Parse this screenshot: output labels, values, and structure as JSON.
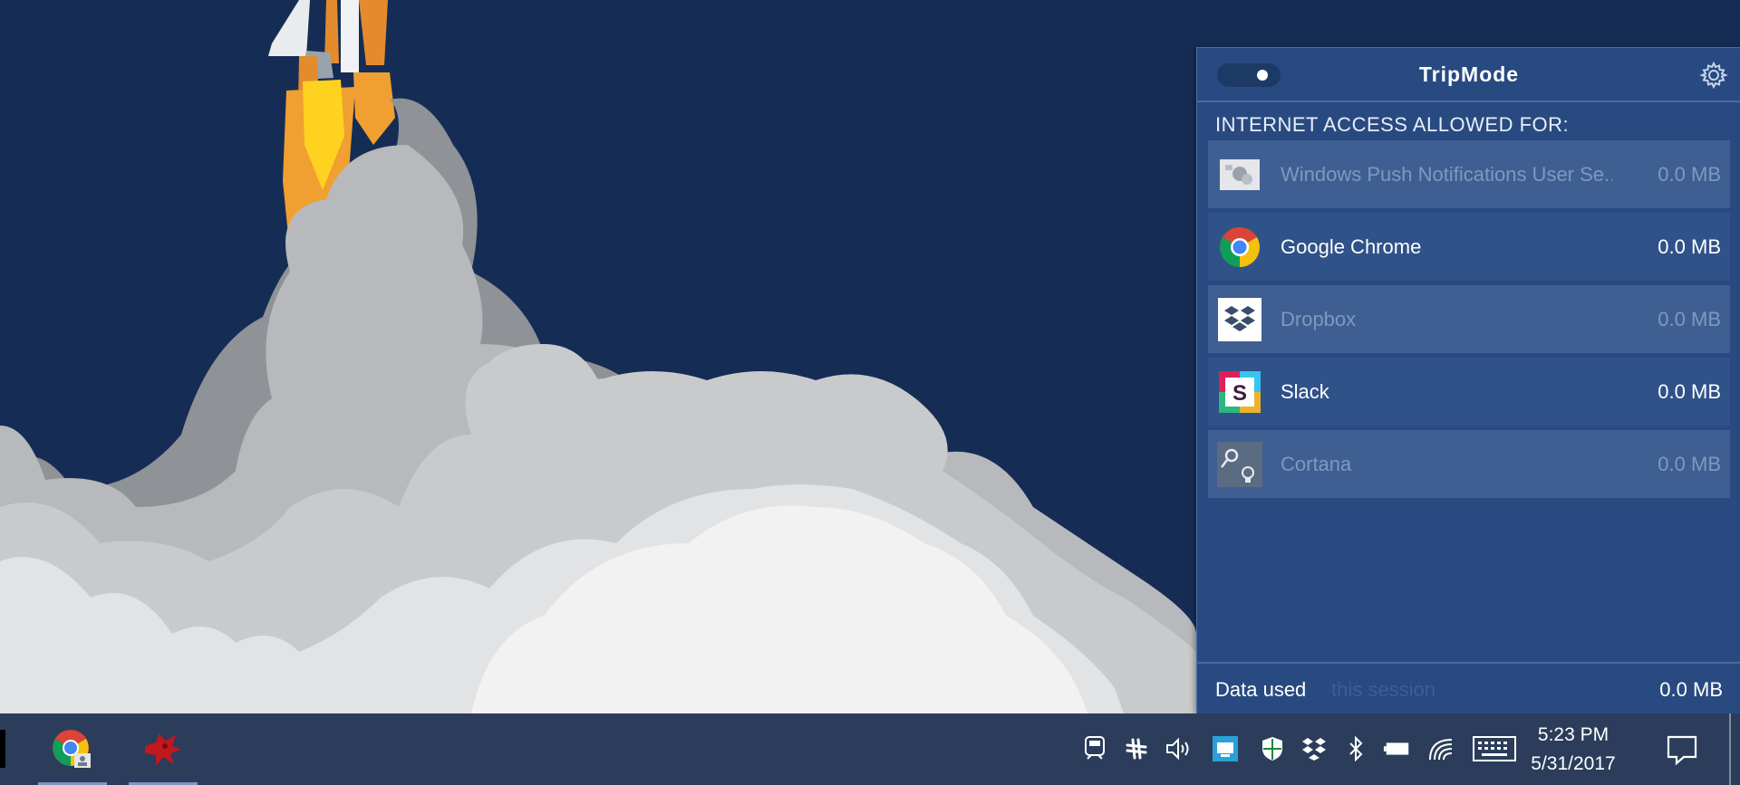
{
  "tripmode": {
    "title": "TripMode",
    "toggle_state": "on",
    "settings_icon": "gear-icon",
    "section_title": "INTERNET ACCESS ALLOWED FOR:",
    "apps": [
      {
        "name": "Windows Push Notifications User Se...",
        "usage": "0.0 MB",
        "enabled": false,
        "icon": "windows-push-notifications-icon"
      },
      {
        "name": "Google Chrome",
        "usage": "0.0 MB",
        "enabled": true,
        "icon": "chrome-icon"
      },
      {
        "name": "Dropbox",
        "usage": "0.0 MB",
        "enabled": false,
        "icon": "dropbox-icon"
      },
      {
        "name": "Slack",
        "usage": "0.0 MB",
        "enabled": true,
        "icon": "slack-icon"
      },
      {
        "name": "Cortana",
        "usage": "0.0 MB",
        "enabled": false,
        "icon": "cortana-icon"
      }
    ],
    "footer": {
      "label": "Data used",
      "period": "this session",
      "value": "0.0 MB"
    }
  },
  "taskbar": {
    "apps": [
      {
        "name": "Google Chrome",
        "icon": "chrome-icon",
        "active": true
      },
      {
        "name": "TripMode",
        "icon": "bird-icon",
        "active": true
      }
    ],
    "tray_icons": [
      "tripmode-icon",
      "slack-icon",
      "volume-icon",
      "app-icon",
      "defender-icon",
      "dropbox-icon",
      "bluetooth-icon",
      "battery-icon",
      "wifi-icon",
      "keyboard-icon"
    ],
    "clock": {
      "time": "5:23 PM",
      "date": "5/31/2017"
    },
    "notification_icon": "action-center-icon"
  },
  "colors": {
    "desktop_background": "#152d55",
    "panel_background": "#284a80",
    "taskbar_background": "#2b3d5b",
    "disabled_text": "#7f98bf"
  }
}
